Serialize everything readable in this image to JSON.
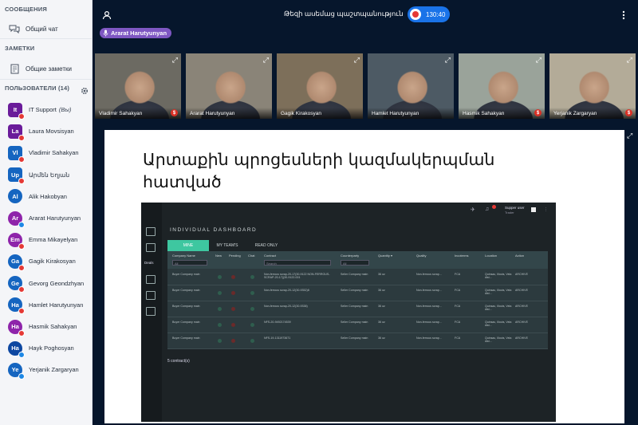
{
  "sidebar": {
    "messages_title": "СООБЩЕНИЯ",
    "public_chat": "Общий чат",
    "notes_title": "ЗАМЕТКИ",
    "shared_notes": "Общие заметки",
    "users_title": "ПОЛЬЗОВАТЕЛИ (14)",
    "users": [
      {
        "initials": "It",
        "name": "IT Support",
        "suffix": "(Вы)",
        "color": "#6a1b9a",
        "status": "#e53935",
        "round": false
      },
      {
        "initials": "La",
        "name": "Laura Movsisyan",
        "suffix": "",
        "color": "#6a1b9a",
        "status": "#e53935",
        "round": false
      },
      {
        "initials": "Vl",
        "name": "Vladimir Sahakyan",
        "suffix": "",
        "color": "#1565c0",
        "status": "#e53935",
        "round": false
      },
      {
        "initials": "Up",
        "name": "Արմեն Եղյան",
        "suffix": "",
        "color": "#1565c0",
        "status": "#e53935",
        "round": false
      },
      {
        "initials": "Al",
        "name": "Alik Hakobyan",
        "suffix": "",
        "color": "#1565c0",
        "status": "",
        "round": true
      },
      {
        "initials": "Ar",
        "name": "Ararat Harutyunyan",
        "suffix": "",
        "color": "#8e24aa",
        "status": "#1e88e5",
        "round": true
      },
      {
        "initials": "Em",
        "name": "Emma Mikayelyan",
        "suffix": "",
        "color": "#8e24aa",
        "status": "#e53935",
        "round": true
      },
      {
        "initials": "Ga",
        "name": "Gagik Kirakosyan",
        "suffix": "",
        "color": "#1565c0",
        "status": "#e53935",
        "round": true
      },
      {
        "initials": "Ge",
        "name": "Gevorg Geondzhyan",
        "suffix": "",
        "color": "#1565c0",
        "status": "#e53935",
        "round": true
      },
      {
        "initials": "Ha",
        "name": "Hamlet Harutyunyan",
        "suffix": "",
        "color": "#1565c0",
        "status": "#e53935",
        "round": true
      },
      {
        "initials": "Ha",
        "name": "Hasmik Sahakyan",
        "suffix": "",
        "color": "#8e24aa",
        "status": "#e53935",
        "round": true
      },
      {
        "initials": "Ha",
        "name": "Hayk Poghosyan",
        "suffix": "",
        "color": "#0d47a1",
        "status": "#1e88e5",
        "round": true
      },
      {
        "initials": "Ye",
        "name": "Yerjanik Zargaryan",
        "suffix": "",
        "color": "#1565c0",
        "status": "#1e88e5",
        "round": true
      }
    ]
  },
  "topbar": {
    "meeting_title": "Թեզի ասեմաց պաշտպանություն",
    "timer": "130:40",
    "talking_user": "Ararat Harutyunyan"
  },
  "tiles": [
    {
      "name": "Vladimir Sahakyan",
      "muted": true,
      "bg": "#6c6a62"
    },
    {
      "name": "Ararat Harutyunyan",
      "muted": false,
      "bg": "#8a8478"
    },
    {
      "name": "Gagik Kirakosyan",
      "muted": false,
      "bg": "#7d6f5a"
    },
    {
      "name": "Hamlet Harutyunyan",
      "muted": false,
      "bg": "#4d5a64"
    },
    {
      "name": "Hasmik Sahakyan",
      "muted": true,
      "bg": "#9aa39a"
    },
    {
      "name": "Yerjanik Zargaryan",
      "muted": true,
      "bg": "#b3ab98"
    }
  ],
  "slide": {
    "title_line1": "Արտաքին  պրոցեսների կազմակերպման",
    "title_line2": "հատված"
  },
  "dashboard": {
    "header": "INDIVIDUAL DASHBOARD",
    "user_name": "Supper user",
    "user_role": "Trader",
    "tabs": [
      "MINE",
      "MY TEAM'S",
      "READ ONLY"
    ],
    "columns": [
      "Company Name",
      "New",
      "Pending",
      "Chat",
      "Contract",
      "Counterparty",
      "Quantity ▾",
      "Quality",
      "Incoterms",
      "Location",
      "Action"
    ],
    "filter_all": "All",
    "search_placeholder": "Search",
    "rows": [
      {
        "company": "Buyer Company main",
        "contract": "Non-ferrous scrap-20-17(30-9122 NON-FERROUS-SCRAP-20-17)(30-9122-001",
        "counterparty": "Seller Company main",
        "quantity": "36 oz",
        "quality": "Non-ferrous scrap...",
        "incoterms": "FCA",
        "location": "Quinsac, Illovia, Vela dist...",
        "action": "ARCHIVE"
      },
      {
        "company": "Buyer Company main",
        "contract": "Non-ferrous scrap-20-12(30-9352)8",
        "counterparty": "Seller Company main",
        "quantity": "36 oz",
        "quality": "Non-ferrous scrap...",
        "incoterms": "FCA",
        "location": "Quinsac, Illovia, Vela dist...",
        "action": "ARCHIVE"
      },
      {
        "company": "Buyer Company main",
        "contract": "Non-ferrous scrap-20-12(30-9338)",
        "counterparty": "Seller Company main",
        "quantity": "36 oz",
        "quality": "Non-ferrous scrap...",
        "incoterms": "FCA",
        "location": "Quinsac, Illovia, Vela dist...",
        "action": "ARCHIVE"
      },
      {
        "company": "Buyer Company main",
        "contract": "NFS-20-9492174539",
        "counterparty": "Seller Company main",
        "quantity": "36 oz",
        "quality": "Non-ferrous scrap...",
        "incoterms": "FCA",
        "location": "Quinsac, Illovia, Vela dist...",
        "action": "ARCHIVE"
      },
      {
        "company": "Buyer Company main",
        "contract": "NFS-19-1311973671",
        "counterparty": "Seller Company main",
        "quantity": "36 oz",
        "quality": "Non-ferrous scrap...",
        "incoterms": "FCA",
        "location": "Quinsac, Illovia, Vela dist...",
        "action": "ARCHIVE"
      }
    ],
    "count_label": "5 contract(s)",
    "side_label": "Deals"
  }
}
